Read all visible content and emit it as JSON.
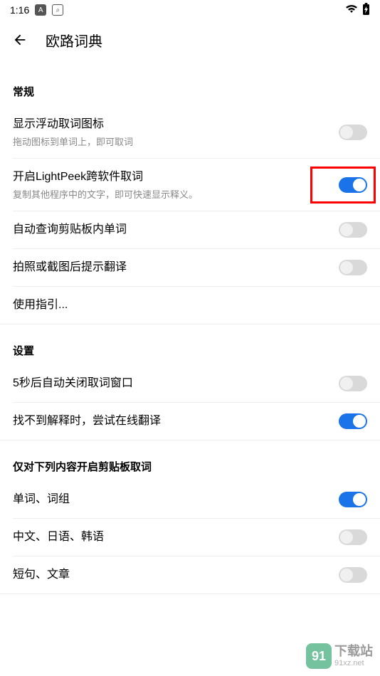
{
  "status": {
    "time": "1:16",
    "icons": {
      "a": "A",
      "search": "⌕"
    }
  },
  "header": {
    "title": "欧路词典"
  },
  "sections": {
    "general": {
      "header": "常规",
      "items": {
        "floatIcon": {
          "title": "显示浮动取词图标",
          "sub": "拖动图标到单词上，即可取词",
          "on": false
        },
        "lightPeek": {
          "title": "开启LightPeek跨软件取词",
          "sub": "复制其他程序中的文字，即可快速显示释义。",
          "on": true
        },
        "clipboard": {
          "title": "自动查询剪贴板内单词",
          "on": false
        },
        "photo": {
          "title": "拍照或截图后提示翻译",
          "on": false
        },
        "guide": {
          "title": "使用指引..."
        }
      }
    },
    "settings": {
      "header": "设置",
      "items": {
        "autoClose": {
          "title": "5秒后自动关闭取词窗口",
          "on": false
        },
        "onlineFallback": {
          "title": "找不到解释时，尝试在线翻译",
          "on": true
        }
      }
    },
    "clipboardFilter": {
      "header": "仅对下列内容开启剪贴板取词",
      "items": {
        "words": {
          "title": "单词、词组",
          "on": true
        },
        "cjk": {
          "title": "中文、日语、韩语",
          "on": false
        },
        "sentence": {
          "title": "短句、文章",
          "on": false
        }
      }
    }
  },
  "watermark": {
    "cn": "下载站",
    "url": "91xz.net",
    "num": "91"
  }
}
